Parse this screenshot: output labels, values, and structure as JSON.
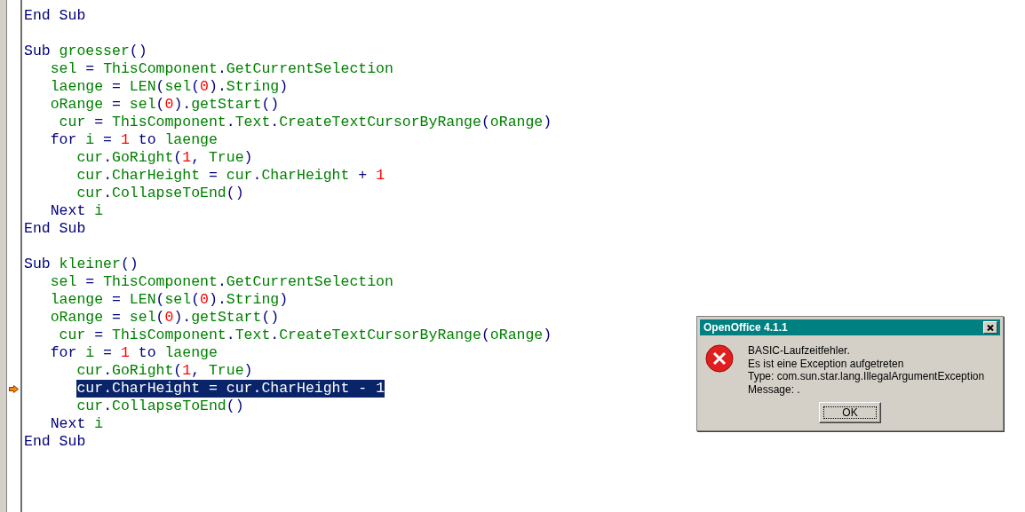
{
  "editor": {
    "lines": [
      {
        "kind": "top",
        "selected": false,
        "current": false,
        "tokens": [
          {
            "kind": "kw",
            "text": "End Sub"
          }
        ]
      },
      {
        "kind": "blank"
      },
      {
        "kind": "top",
        "selected": false,
        "current": false,
        "tokens": [
          {
            "kind": "kw",
            "text": "Sub "
          },
          {
            "kind": "id",
            "text": "groesser"
          },
          {
            "kind": "op",
            "text": "()"
          }
        ]
      },
      {
        "kind": "block",
        "selected": false,
        "current": false,
        "tokens": [
          {
            "kind": "id",
            "text": "sel"
          },
          {
            "kind": "op",
            "text": " = "
          },
          {
            "kind": "id",
            "text": "ThisComponent"
          },
          {
            "kind": "op",
            "text": "."
          },
          {
            "kind": "id",
            "text": "GetCurrentSelection"
          }
        ]
      },
      {
        "kind": "block",
        "selected": false,
        "current": false,
        "tokens": [
          {
            "kind": "id",
            "text": "laenge"
          },
          {
            "kind": "op",
            "text": " = "
          },
          {
            "kind": "id",
            "text": "LEN"
          },
          {
            "kind": "op",
            "text": "("
          },
          {
            "kind": "id",
            "text": "sel"
          },
          {
            "kind": "op",
            "text": "("
          },
          {
            "kind": "num",
            "text": "0"
          },
          {
            "kind": "op",
            "text": ")."
          },
          {
            "kind": "id",
            "text": "String"
          },
          {
            "kind": "op",
            "text": ")"
          }
        ]
      },
      {
        "kind": "block",
        "selected": false,
        "current": false,
        "tokens": [
          {
            "kind": "id",
            "text": "oRange"
          },
          {
            "kind": "op",
            "text": " = "
          },
          {
            "kind": "id",
            "text": "sel"
          },
          {
            "kind": "op",
            "text": "("
          },
          {
            "kind": "num",
            "text": "0"
          },
          {
            "kind": "op",
            "text": ")."
          },
          {
            "kind": "id",
            "text": "getStart"
          },
          {
            "kind": "op",
            "text": "()"
          }
        ]
      },
      {
        "kind": "shifted",
        "selected": false,
        "current": false,
        "tokens": [
          {
            "kind": "id",
            "text": "cur"
          },
          {
            "kind": "op",
            "text": " = "
          },
          {
            "kind": "id",
            "text": "ThisComponent"
          },
          {
            "kind": "op",
            "text": "."
          },
          {
            "kind": "id",
            "text": "Text"
          },
          {
            "kind": "op",
            "text": "."
          },
          {
            "kind": "id",
            "text": "CreateTextCursorByRange"
          },
          {
            "kind": "op",
            "text": "("
          },
          {
            "kind": "id",
            "text": "oRange"
          },
          {
            "kind": "op",
            "text": ")"
          }
        ]
      },
      {
        "kind": "block",
        "selected": false,
        "current": false,
        "tokens": [
          {
            "kind": "kw",
            "text": "for "
          },
          {
            "kind": "id",
            "text": "i"
          },
          {
            "kind": "op",
            "text": " = "
          },
          {
            "kind": "num",
            "text": "1"
          },
          {
            "kind": "kw",
            "text": " to "
          },
          {
            "kind": "id",
            "text": "laenge"
          }
        ]
      },
      {
        "kind": "loop",
        "selected": false,
        "current": false,
        "tokens": [
          {
            "kind": "id",
            "text": "cur"
          },
          {
            "kind": "op",
            "text": "."
          },
          {
            "kind": "id",
            "text": "GoRight"
          },
          {
            "kind": "op",
            "text": "("
          },
          {
            "kind": "num",
            "text": "1"
          },
          {
            "kind": "op",
            "text": ", "
          },
          {
            "kind": "id",
            "text": "True"
          },
          {
            "kind": "op",
            "text": ")"
          }
        ]
      },
      {
        "kind": "loop",
        "selected": false,
        "current": false,
        "tokens": [
          {
            "kind": "id",
            "text": "cur"
          },
          {
            "kind": "op",
            "text": "."
          },
          {
            "kind": "id",
            "text": "CharHeight"
          },
          {
            "kind": "op",
            "text": " = "
          },
          {
            "kind": "id",
            "text": "cur"
          },
          {
            "kind": "op",
            "text": "."
          },
          {
            "kind": "id",
            "text": "CharHeight"
          },
          {
            "kind": "op",
            "text": " + "
          },
          {
            "kind": "num",
            "text": "1"
          }
        ]
      },
      {
        "kind": "loop",
        "selected": false,
        "current": false,
        "tokens": [
          {
            "kind": "id",
            "text": "cur"
          },
          {
            "kind": "op",
            "text": "."
          },
          {
            "kind": "id",
            "text": "CollapseToEnd"
          },
          {
            "kind": "op",
            "text": "()"
          }
        ]
      },
      {
        "kind": "block",
        "selected": false,
        "current": false,
        "tokens": [
          {
            "kind": "kw",
            "text": "Next "
          },
          {
            "kind": "id",
            "text": "i"
          }
        ]
      },
      {
        "kind": "top",
        "selected": false,
        "current": false,
        "tokens": [
          {
            "kind": "kw",
            "text": "End Sub"
          }
        ]
      },
      {
        "kind": "blank"
      },
      {
        "kind": "top",
        "selected": false,
        "current": false,
        "tokens": [
          {
            "kind": "kw",
            "text": "Sub "
          },
          {
            "kind": "id",
            "text": "kleiner"
          },
          {
            "kind": "op",
            "text": "()"
          }
        ]
      },
      {
        "kind": "block",
        "selected": false,
        "current": false,
        "tokens": [
          {
            "kind": "id",
            "text": "sel"
          },
          {
            "kind": "op",
            "text": " = "
          },
          {
            "kind": "id",
            "text": "ThisComponent"
          },
          {
            "kind": "op",
            "text": "."
          },
          {
            "kind": "id",
            "text": "GetCurrentSelection"
          }
        ]
      },
      {
        "kind": "block",
        "selected": false,
        "current": false,
        "tokens": [
          {
            "kind": "id",
            "text": "laenge"
          },
          {
            "kind": "op",
            "text": " = "
          },
          {
            "kind": "id",
            "text": "LEN"
          },
          {
            "kind": "op",
            "text": "("
          },
          {
            "kind": "id",
            "text": "sel"
          },
          {
            "kind": "op",
            "text": "("
          },
          {
            "kind": "num",
            "text": "0"
          },
          {
            "kind": "op",
            "text": ")."
          },
          {
            "kind": "id",
            "text": "String"
          },
          {
            "kind": "op",
            "text": ")"
          }
        ]
      },
      {
        "kind": "block",
        "selected": false,
        "current": false,
        "tokens": [
          {
            "kind": "id",
            "text": "oRange"
          },
          {
            "kind": "op",
            "text": " = "
          },
          {
            "kind": "id",
            "text": "sel"
          },
          {
            "kind": "op",
            "text": "("
          },
          {
            "kind": "num",
            "text": "0"
          },
          {
            "kind": "op",
            "text": ")."
          },
          {
            "kind": "id",
            "text": "getStart"
          },
          {
            "kind": "op",
            "text": "()"
          }
        ]
      },
      {
        "kind": "shifted",
        "selected": false,
        "current": false,
        "tokens": [
          {
            "kind": "id",
            "text": "cur"
          },
          {
            "kind": "op",
            "text": " = "
          },
          {
            "kind": "id",
            "text": "ThisComponent"
          },
          {
            "kind": "op",
            "text": "."
          },
          {
            "kind": "id",
            "text": "Text"
          },
          {
            "kind": "op",
            "text": "."
          },
          {
            "kind": "id",
            "text": "CreateTextCursorByRange"
          },
          {
            "kind": "op",
            "text": "("
          },
          {
            "kind": "id",
            "text": "oRange"
          },
          {
            "kind": "op",
            "text": ")"
          }
        ]
      },
      {
        "kind": "block",
        "selected": false,
        "current": false,
        "tokens": [
          {
            "kind": "kw",
            "text": "for "
          },
          {
            "kind": "id",
            "text": "i"
          },
          {
            "kind": "op",
            "text": " = "
          },
          {
            "kind": "num",
            "text": "1"
          },
          {
            "kind": "kw",
            "text": " to "
          },
          {
            "kind": "id",
            "text": "laenge"
          }
        ]
      },
      {
        "kind": "loop",
        "selected": false,
        "current": false,
        "tokens": [
          {
            "kind": "id",
            "text": "cur"
          },
          {
            "kind": "op",
            "text": "."
          },
          {
            "kind": "id",
            "text": "GoRight"
          },
          {
            "kind": "op",
            "text": "("
          },
          {
            "kind": "num",
            "text": "1"
          },
          {
            "kind": "op",
            "text": ", "
          },
          {
            "kind": "id",
            "text": "True"
          },
          {
            "kind": "op",
            "text": ")"
          }
        ]
      },
      {
        "kind": "loop",
        "selected": true,
        "current": true,
        "tokens": [
          {
            "kind": "id",
            "text": "cur"
          },
          {
            "kind": "op",
            "text": "."
          },
          {
            "kind": "id",
            "text": "CharHeight"
          },
          {
            "kind": "op",
            "text": " = "
          },
          {
            "kind": "id",
            "text": "cur"
          },
          {
            "kind": "op",
            "text": "."
          },
          {
            "kind": "id",
            "text": "CharHeight"
          },
          {
            "kind": "op",
            "text": " - "
          },
          {
            "kind": "num",
            "text": "1"
          }
        ]
      },
      {
        "kind": "loop",
        "selected": false,
        "current": false,
        "tokens": [
          {
            "kind": "id",
            "text": "cur"
          },
          {
            "kind": "op",
            "text": "."
          },
          {
            "kind": "id",
            "text": "CollapseToEnd"
          },
          {
            "kind": "op",
            "text": "()"
          }
        ]
      },
      {
        "kind": "block",
        "selected": false,
        "current": false,
        "tokens": [
          {
            "kind": "kw",
            "text": "Next "
          },
          {
            "kind": "id",
            "text": "i"
          }
        ]
      },
      {
        "kind": "top",
        "selected": false,
        "current": false,
        "tokens": [
          {
            "kind": "kw",
            "text": "End Sub"
          }
        ]
      }
    ]
  },
  "dialog": {
    "title": "OpenOffice 4.1.1",
    "message": [
      "BASIC-Laufzeitfehler.",
      "Es ist eine Exception aufgetreten",
      "Type: com.sun.star.lang.IllegalArgumentException",
      "Message: ."
    ],
    "button": "OK"
  }
}
